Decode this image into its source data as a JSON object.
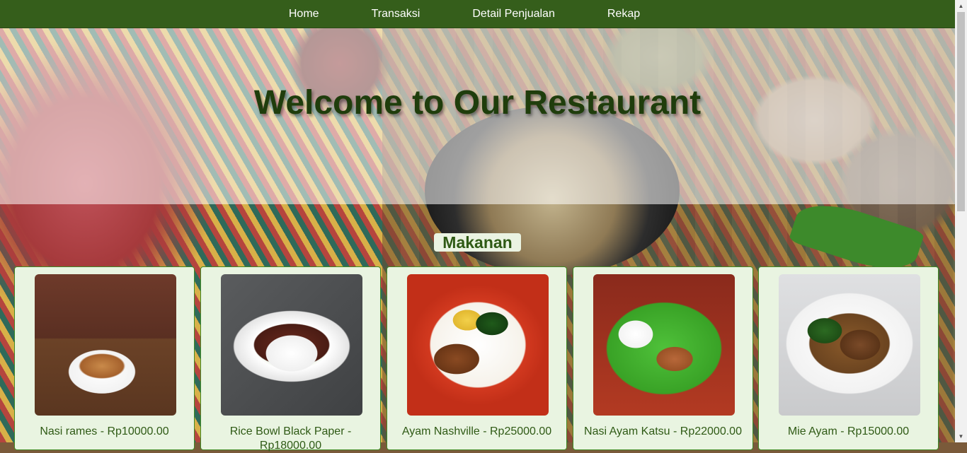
{
  "nav": {
    "items": [
      {
        "label": "Home"
      },
      {
        "label": "Transaksi"
      },
      {
        "label": "Detail Penjualan"
      },
      {
        "label": "Rekap"
      }
    ]
  },
  "hero": {
    "title": "Welcome to Our Restaurant"
  },
  "menu": {
    "section_label": "Makanan",
    "items": [
      {
        "name": "Nasi rames - Rp10000.00"
      },
      {
        "name": "Rice Bowl Black Paper - Rp18000.00"
      },
      {
        "name": "Ayam Nashville - Rp25000.00"
      },
      {
        "name": "Nasi Ayam Katsu - Rp22000.00"
      },
      {
        "name": "Mie Ayam - Rp15000.00"
      }
    ]
  },
  "colors": {
    "nav_background": "#355e1b",
    "title_color": "#1f3d0c",
    "card_background": "#e9f4e1",
    "card_border": "#3f8a24"
  }
}
